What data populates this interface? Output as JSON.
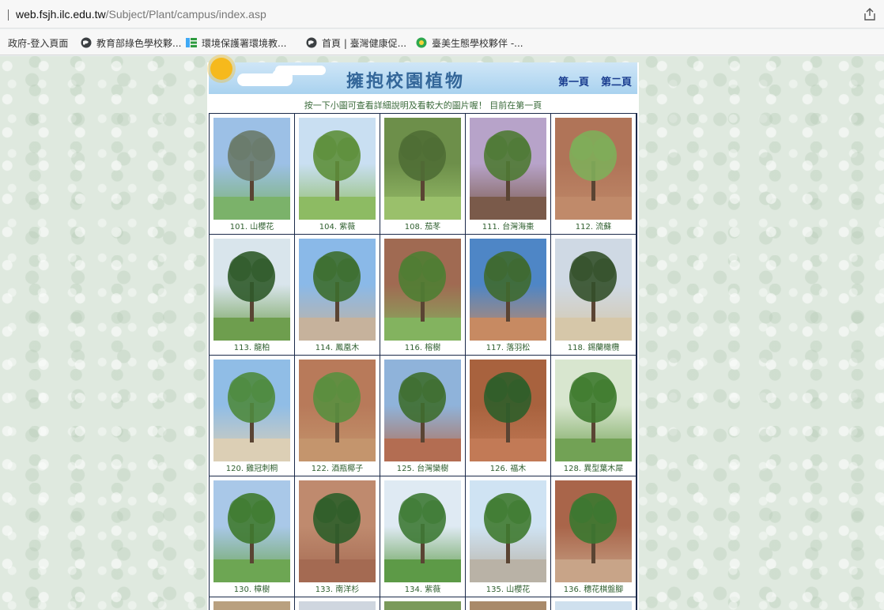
{
  "browser": {
    "url_domain": "web.fsjh.ilc.edu.tw",
    "url_path": "/Subject/Plant/campus/index.asp",
    "share_icon": "share-icon",
    "bookmarks": [
      {
        "label": "政府-登入頁面",
        "icon": "none"
      },
      {
        "label": "教育部綠色學校夥...",
        "icon": "globe-icon"
      },
      {
        "label": "環境保護署環境教...",
        "icon": "epa-logo-icon"
      },
      {
        "label": "首頁 | 臺灣健康促...",
        "icon": "globe-icon"
      },
      {
        "label": "臺美生態學校夥伴 -...",
        "icon": "green-circle-icon"
      }
    ]
  },
  "banner": {
    "title": "擁抱校園植物",
    "page1": "第一頁",
    "page2": "第二頁"
  },
  "instruction": "按一下小圖可查看詳細說明及看較大的圖片喔！ 目前在第一頁",
  "plants": [
    {
      "label": "101. 山櫻花"
    },
    {
      "label": "104. 紫薇"
    },
    {
      "label": "108. 茄苳"
    },
    {
      "label": "111. 台灣海棗"
    },
    {
      "label": "112. 流蘇"
    },
    {
      "label": "113. 龍柏"
    },
    {
      "label": "114. 鳳凰木"
    },
    {
      "label": "116. 榕樹"
    },
    {
      "label": "117. 落羽松"
    },
    {
      "label": "118. 錫蘭橄欖"
    },
    {
      "label": "120. 雞冠刺桐"
    },
    {
      "label": "122. 酒瓶椰子"
    },
    {
      "label": "125. 台灣欒樹"
    },
    {
      "label": "126. 福木"
    },
    {
      "label": "128. 異型葉木犀"
    },
    {
      "label": "130. 樟樹"
    },
    {
      "label": "133. 南洋杉"
    },
    {
      "label": "134. 紫薇"
    },
    {
      "label": "135. 山櫻花"
    },
    {
      "label": "136. 穗花棋盤腳"
    }
  ],
  "colors": {
    "caption": "#2f5f2f",
    "nav": "#1a3d8f",
    "title": "#336699",
    "grid_border": "#1b2a4a"
  }
}
